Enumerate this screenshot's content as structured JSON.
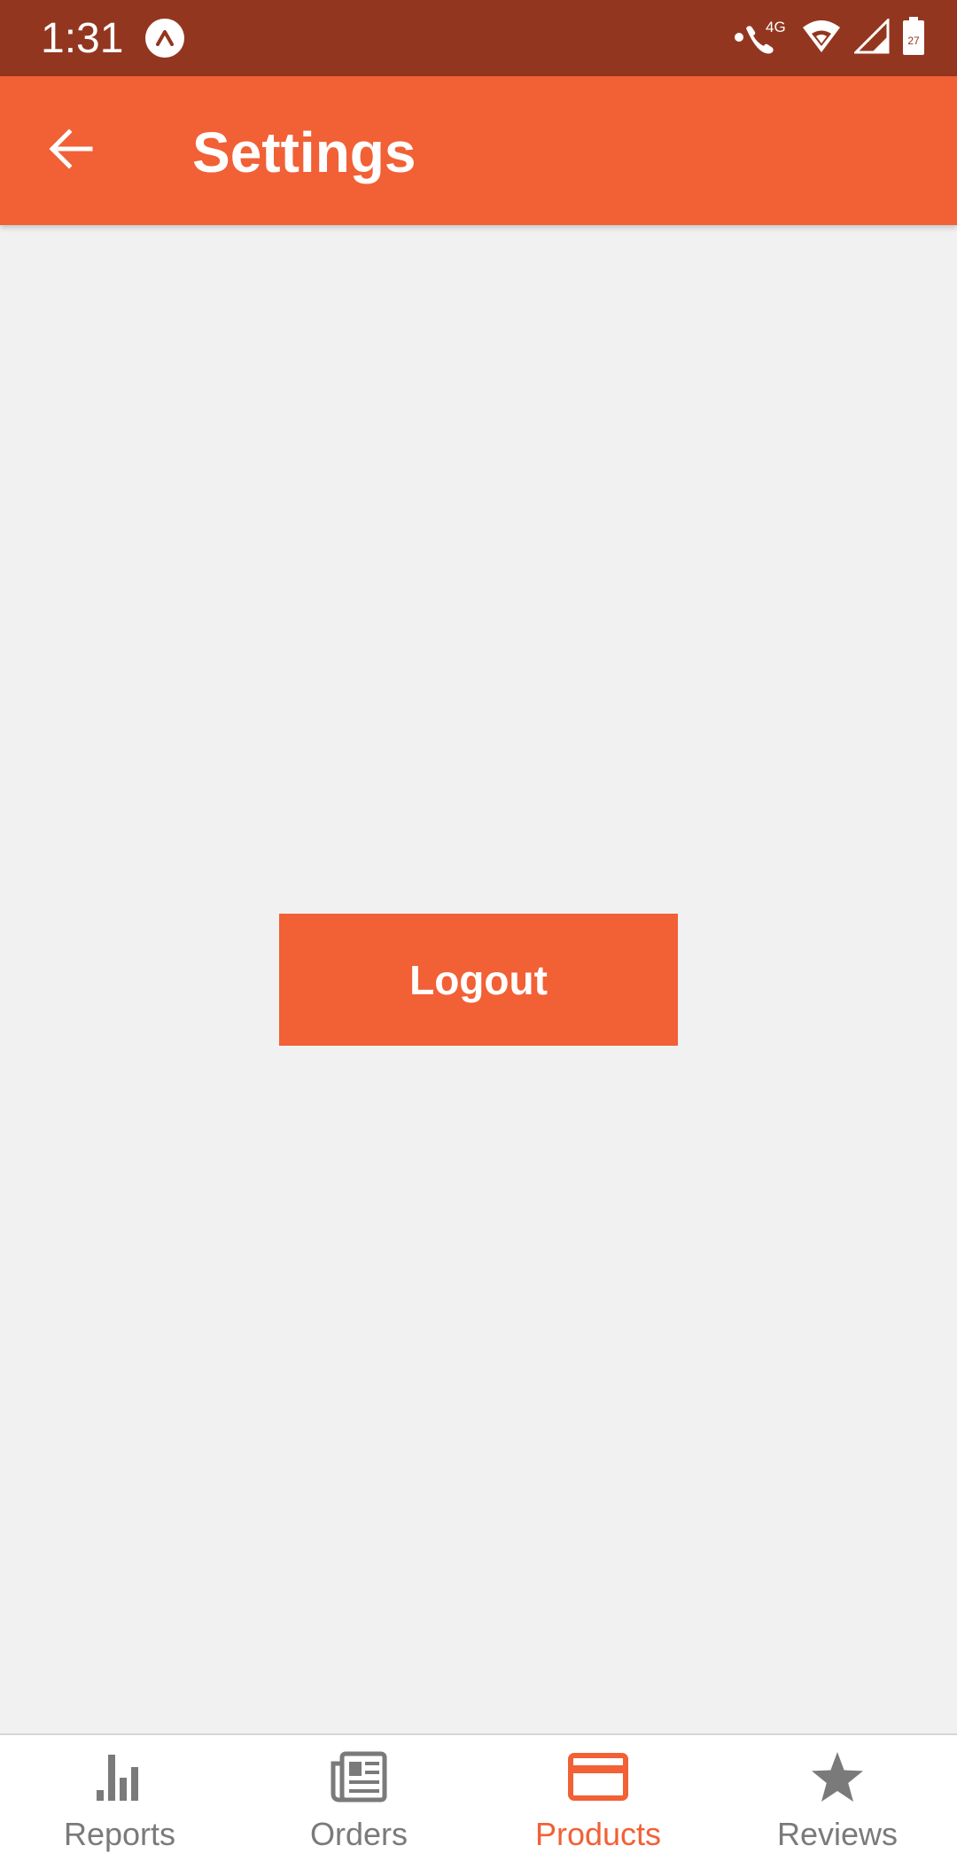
{
  "status_bar": {
    "time": "1:31",
    "network_type": "4G",
    "battery_level": "27",
    "icons": [
      "app-notification-icon",
      "wifi-calling-icon",
      "wifi-icon",
      "cell-signal-icon",
      "battery-icon"
    ]
  },
  "app_bar": {
    "title": "Settings",
    "back_icon": "arrow-left-icon"
  },
  "main": {
    "logout_label": "Logout"
  },
  "bottom_nav": {
    "items": [
      {
        "label": "Reports",
        "icon": "bar-chart-icon",
        "active": false
      },
      {
        "label": "Orders",
        "icon": "newspaper-icon",
        "active": false
      },
      {
        "label": "Products",
        "icon": "credit-card-icon",
        "active": true
      },
      {
        "label": "Reviews",
        "icon": "star-icon",
        "active": false
      }
    ]
  },
  "colors": {
    "status_bar": "#933620",
    "accent": "#f26035",
    "background": "#f1f1f1",
    "inactive": "#7a7a7a"
  }
}
